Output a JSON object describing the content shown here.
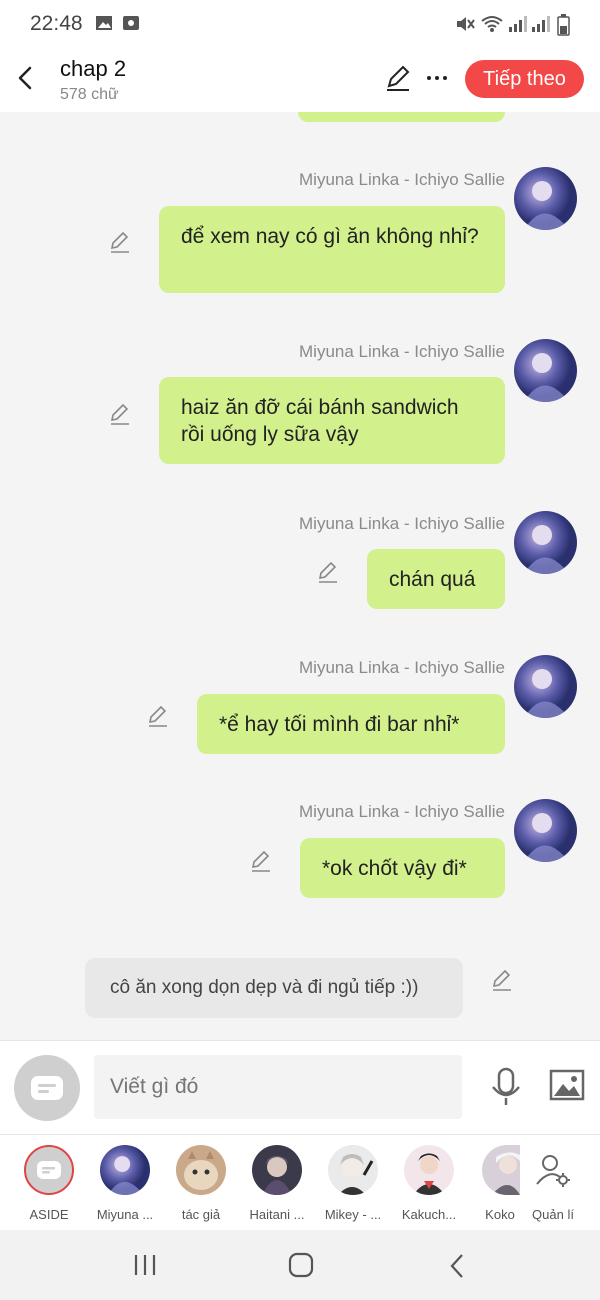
{
  "status": {
    "time": "22:48"
  },
  "header": {
    "title": "chap 2",
    "subtitle": "578 chữ",
    "next_label": "Tiếp theo"
  },
  "messages": [
    {
      "name": "Miyuna Linka - Ichiyo Sallie",
      "text": "để xem nay có gì ăn không nhỉ?"
    },
    {
      "name": "Miyuna Linka - Ichiyo Sallie",
      "text": "haiz ăn đỡ cái bánh sandwich rồi uống ly sữa vậy"
    },
    {
      "name": "Miyuna Linka - Ichiyo Sallie",
      "text": "chán quá"
    },
    {
      "name": "Miyuna Linka - Ichiyo Sallie",
      "text": "*ể hay tối mình đi bar nhỉ*"
    },
    {
      "name": "Miyuna Linka - Ichiyo Sallie",
      "text": "*ok chốt vậy đi*"
    }
  ],
  "aside": {
    "text": "cô ăn xong dọn dẹp và đi ngủ tiếp :))"
  },
  "input": {
    "placeholder": "Viết gì đó"
  },
  "characters": [
    {
      "label": "ASIDE"
    },
    {
      "label": "Miyuna ..."
    },
    {
      "label": "tác giả"
    },
    {
      "label": "Haitani ..."
    },
    {
      "label": "Mikey - ..."
    },
    {
      "label": "Kakuch..."
    },
    {
      "label": "Koko"
    },
    {
      "label": "Quản lí"
    }
  ],
  "colors": {
    "accent": "#f24848",
    "bubble": "#d2f08c",
    "background": "#f4f4f4"
  }
}
